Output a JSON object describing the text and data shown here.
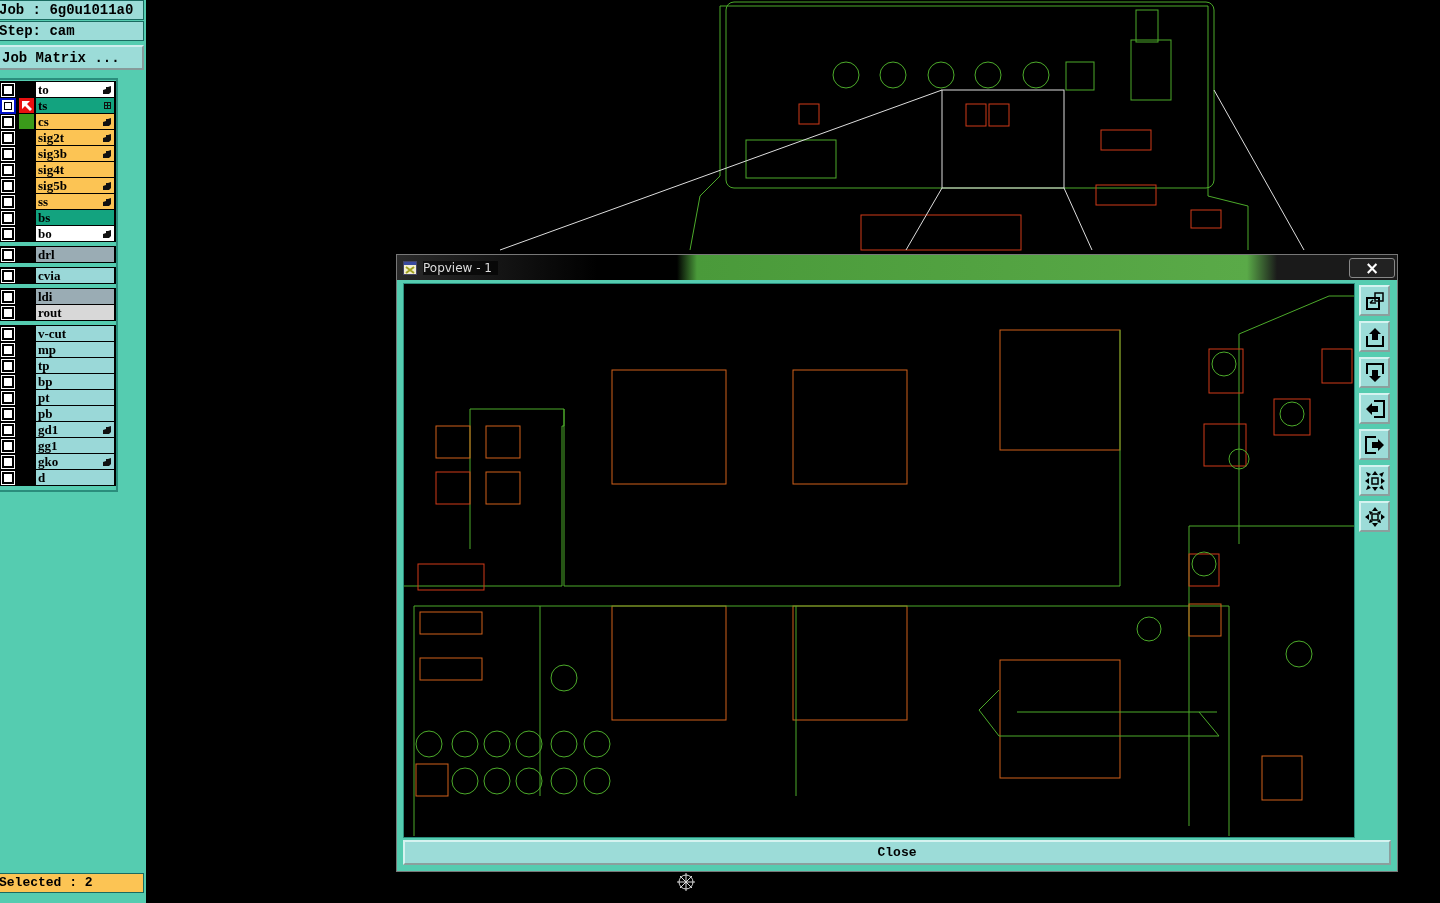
{
  "job": {
    "label": "Job",
    "separator": ":",
    "value": "6g0u1011a0"
  },
  "step": {
    "label": "Step:",
    "value": "cam"
  },
  "job_matrix_button": "Job Matrix ...",
  "layer_groups": [
    [
      {
        "name": "to",
        "color": "#ffffff",
        "selected": false,
        "work": false,
        "displayed": false,
        "kind": "hand"
      },
      {
        "name": "ts",
        "color": "#13a37f",
        "selected": true,
        "work": true,
        "displayed": false,
        "kind": "grid"
      },
      {
        "name": "cs",
        "color": "#fcc454",
        "selected": false,
        "work": false,
        "displayed": true,
        "kind": "hand"
      },
      {
        "name": "sig2t",
        "color": "#fcc454",
        "selected": false,
        "work": false,
        "displayed": false,
        "kind": "hand"
      },
      {
        "name": "sig3b",
        "color": "#fcc454",
        "selected": false,
        "work": false,
        "displayed": false,
        "kind": "hand"
      },
      {
        "name": "sig4t",
        "color": "#fcc454",
        "selected": false,
        "work": false,
        "displayed": false,
        "kind": "plain"
      },
      {
        "name": "sig5b",
        "color": "#fcc454",
        "selected": false,
        "work": false,
        "displayed": false,
        "kind": "hand"
      },
      {
        "name": "ss",
        "color": "#fcc454",
        "selected": false,
        "work": false,
        "displayed": false,
        "kind": "hand"
      },
      {
        "name": "bs",
        "color": "#13a37f",
        "selected": false,
        "work": false,
        "displayed": false,
        "kind": "plain"
      },
      {
        "name": "bo",
        "color": "#ffffff",
        "selected": false,
        "work": false,
        "displayed": false,
        "kind": "hand"
      }
    ],
    [
      {
        "name": "drl",
        "color": "#9aacb4",
        "selected": false,
        "work": false,
        "displayed": false,
        "kind": "plain"
      }
    ],
    [
      {
        "name": "cvia",
        "color": "#9ad8d8",
        "selected": false,
        "work": false,
        "displayed": false,
        "kind": "plain"
      }
    ],
    [
      {
        "name": "ldi",
        "color": "#9aacb4",
        "selected": false,
        "work": false,
        "displayed": false,
        "kind": "plain"
      },
      {
        "name": "rout",
        "color": "#d8d8d8",
        "selected": false,
        "work": false,
        "displayed": false,
        "kind": "plain"
      }
    ],
    [
      {
        "name": "v-cut",
        "color": "#9ad8d8",
        "selected": false,
        "work": false,
        "displayed": false,
        "kind": "plain"
      },
      {
        "name": "mp",
        "color": "#9ad8d8",
        "selected": false,
        "work": false,
        "displayed": false,
        "kind": "plain"
      },
      {
        "name": "tp",
        "color": "#9ad8d8",
        "selected": false,
        "work": false,
        "displayed": false,
        "kind": "plain"
      },
      {
        "name": "bp",
        "color": "#9ad8d8",
        "selected": false,
        "work": false,
        "displayed": false,
        "kind": "plain"
      },
      {
        "name": "pt",
        "color": "#9ad8d8",
        "selected": false,
        "work": false,
        "displayed": false,
        "kind": "plain"
      },
      {
        "name": "pb",
        "color": "#9ad8d8",
        "selected": false,
        "work": false,
        "displayed": false,
        "kind": "plain"
      },
      {
        "name": "gd1",
        "color": "#9ad8d8",
        "selected": false,
        "work": false,
        "displayed": false,
        "kind": "hand"
      },
      {
        "name": "gg1",
        "color": "#9ad8d8",
        "selected": false,
        "work": false,
        "displayed": false,
        "kind": "plain"
      },
      {
        "name": "gko",
        "color": "#9ad8d8",
        "selected": false,
        "work": false,
        "displayed": false,
        "kind": "hand"
      },
      {
        "name": "d",
        "color": "#9ad8d8",
        "selected": false,
        "work": false,
        "displayed": false,
        "kind": "plain"
      }
    ]
  ],
  "selected_status": "Selected : 2",
  "popview": {
    "title": "Popview - 1",
    "close_glyph": "×",
    "close_button": "Close",
    "tools": [
      {
        "kind": "zoom-home"
      },
      {
        "kind": "pan-up"
      },
      {
        "kind": "pan-down"
      },
      {
        "kind": "pan-left"
      },
      {
        "kind": "pan-right"
      },
      {
        "kind": "zoom-in"
      },
      {
        "kind": "zoom-out"
      }
    ]
  }
}
